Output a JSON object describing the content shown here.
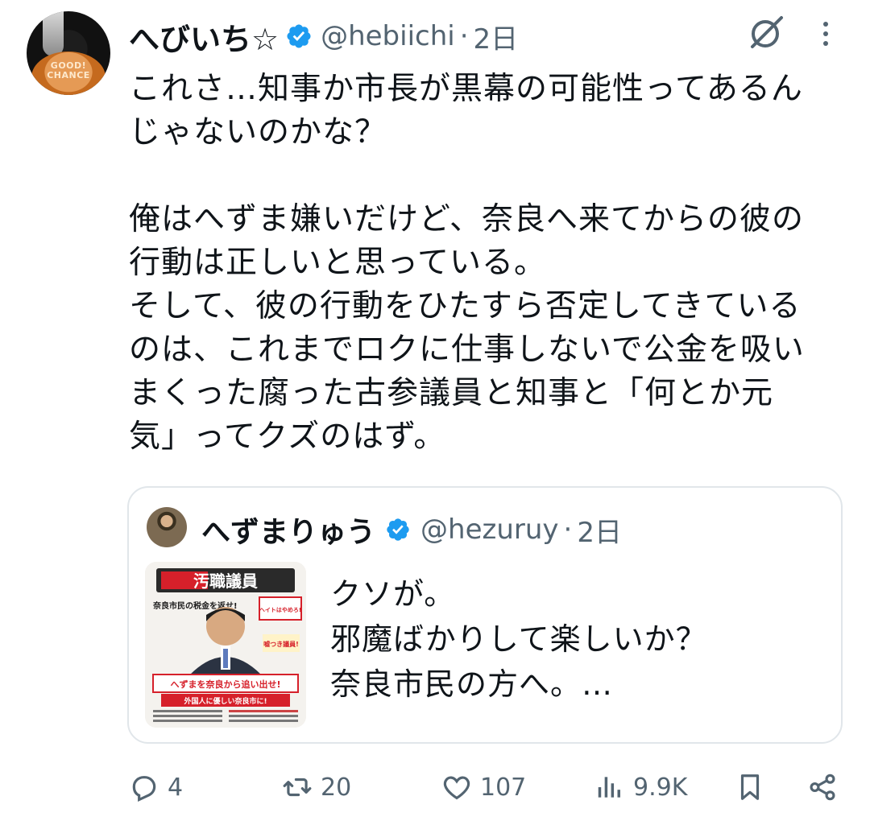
{
  "tweet": {
    "display_name": "へびいち☆",
    "handle": "@hebiichi",
    "separator": "·",
    "time": "2日",
    "avatar_text": "GOOD! CHANCE",
    "body": "これさ…知事か市長が黒幕の可能性ってあるん\nじゃないのかな？\n\n俺はへずま嫌いだけど、奈良へ来てからの彼の\n行動は正しいと思っている。\nそして、彼の行動をひたすら否定してきている\nのは、これまでロクに仕事しないで公金を吸い\nまくった腐った古参議員と知事と「何とか元\n気」ってクズのはず。"
  },
  "quote": {
    "display_name": "へずまりゅう",
    "handle": "@hezuruy",
    "separator": "·",
    "time": "2日",
    "body": "クソが。\n邪魔ばかりして楽しいか？\n奈良市民の方へ。…",
    "thumb": {
      "banner": "汚職議員",
      "left_text": "奈良市民の税金を返せ!",
      "right_text": "ヘイトはやめろ!",
      "badge": "嘘つき議員!",
      "slogan": "へずまを奈良から追い出せ!",
      "sub_slogan": "外国人に優しい奈良市に!"
    }
  },
  "actions": {
    "reply_count": "4",
    "retweet_count": "20",
    "like_count": "107",
    "views_count": "9.9K"
  },
  "icons": {
    "verified": "verified-badge-icon",
    "grok": "grok-icon",
    "more": "more-vertical-icon",
    "reply": "reply-icon",
    "retweet": "retweet-icon",
    "like": "heart-icon",
    "views": "views-icon",
    "bookmark": "bookmark-icon",
    "share": "share-icon"
  },
  "colors": {
    "accent": "#1d9bf0",
    "muted": "#536471",
    "text": "#0f1419"
  }
}
